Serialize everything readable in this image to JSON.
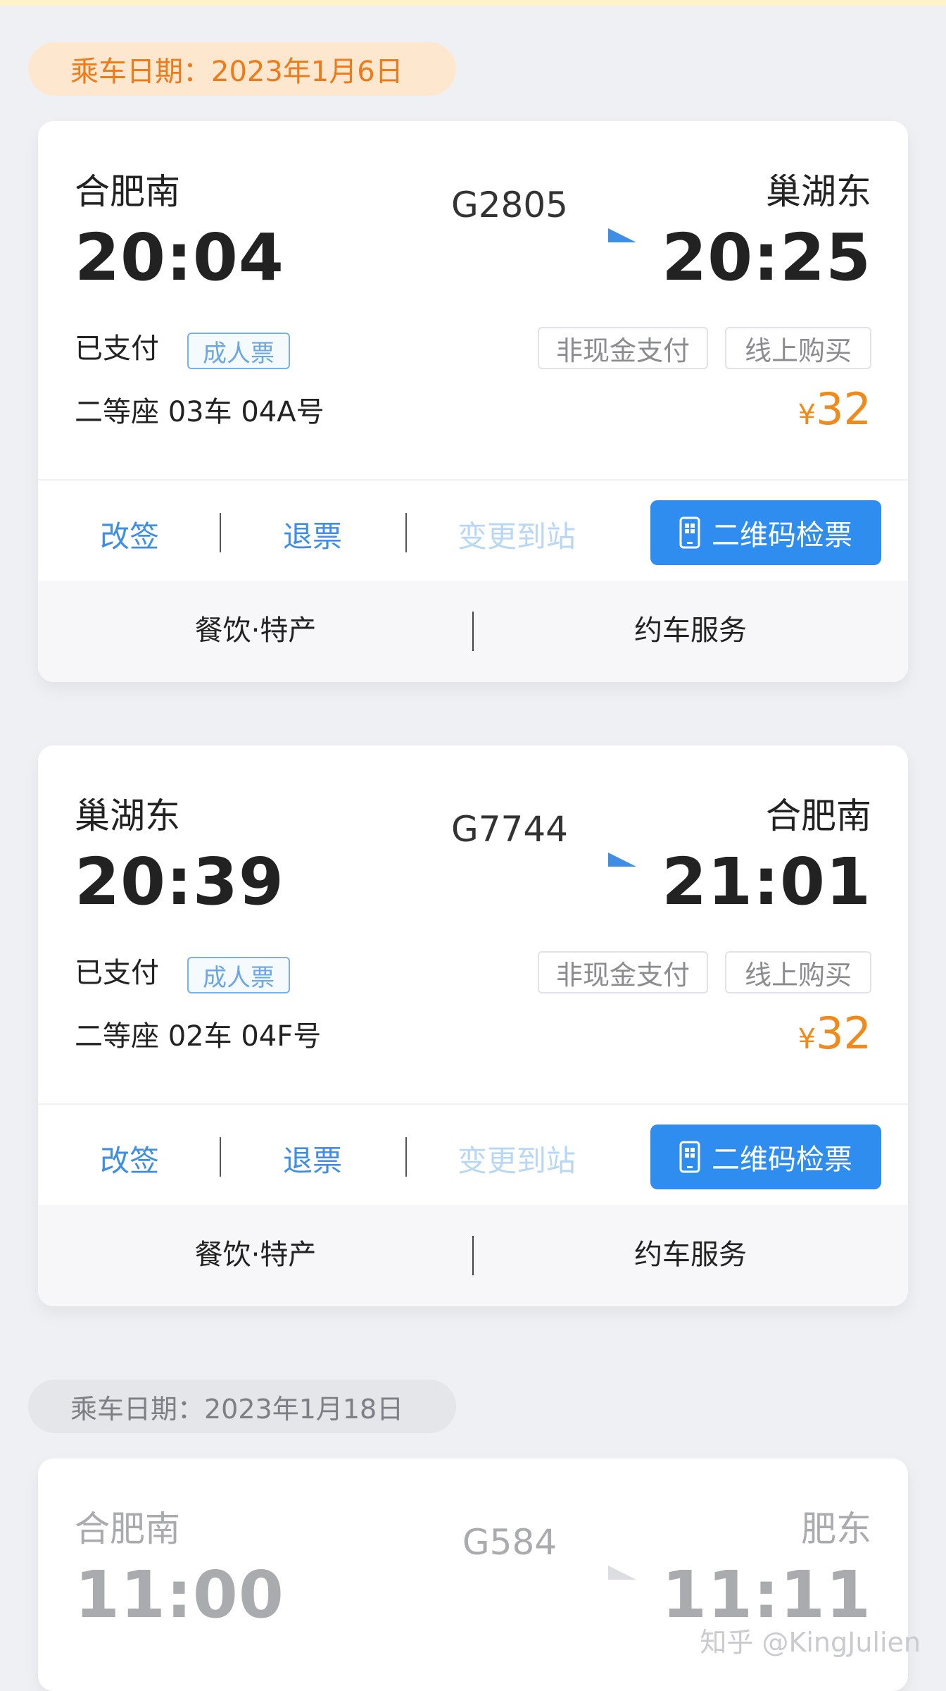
{
  "groups": [
    {
      "date_label": "乘车日期：2023年1月6日",
      "tickets": [
        {
          "from": "合肥南",
          "to": "巢湖东",
          "depart": "20:04",
          "arrive": "20:25",
          "train": "G2805",
          "status": "已支付",
          "ticket_type": "成人票",
          "tags": [
            "非现金支付",
            "线上购买"
          ],
          "seat": "二等座 03车 04A号",
          "currency": "¥",
          "price": "32",
          "actions": {
            "change": "改签",
            "refund": "退票",
            "change_station": "变更到站",
            "qr": "二维码检票"
          },
          "services": {
            "food": "餐饮·特产",
            "car": "约车服务"
          }
        },
        {
          "from": "巢湖东",
          "to": "合肥南",
          "depart": "20:39",
          "arrive": "21:01",
          "train": "G7744",
          "status": "已支付",
          "ticket_type": "成人票",
          "tags": [
            "非现金支付",
            "线上购买"
          ],
          "seat": "二等座 02车 04F号",
          "currency": "¥",
          "price": "32",
          "actions": {
            "change": "改签",
            "refund": "退票",
            "change_station": "变更到站",
            "qr": "二维码检票"
          },
          "services": {
            "food": "餐饮·特产",
            "car": "约车服务"
          }
        }
      ]
    },
    {
      "date_label": "乘车日期：2023年1月18日",
      "tickets": [
        {
          "from": "合肥南",
          "to": "肥东",
          "depart": "11:00",
          "arrive": "11:11",
          "train": "G584"
        }
      ]
    }
  ],
  "watermark": "知乎 @KingJulien",
  "colors": {
    "accent_blue": "#2f8df0",
    "price_orange": "#f08a1a",
    "date_orange": "#ef7a1a"
  }
}
